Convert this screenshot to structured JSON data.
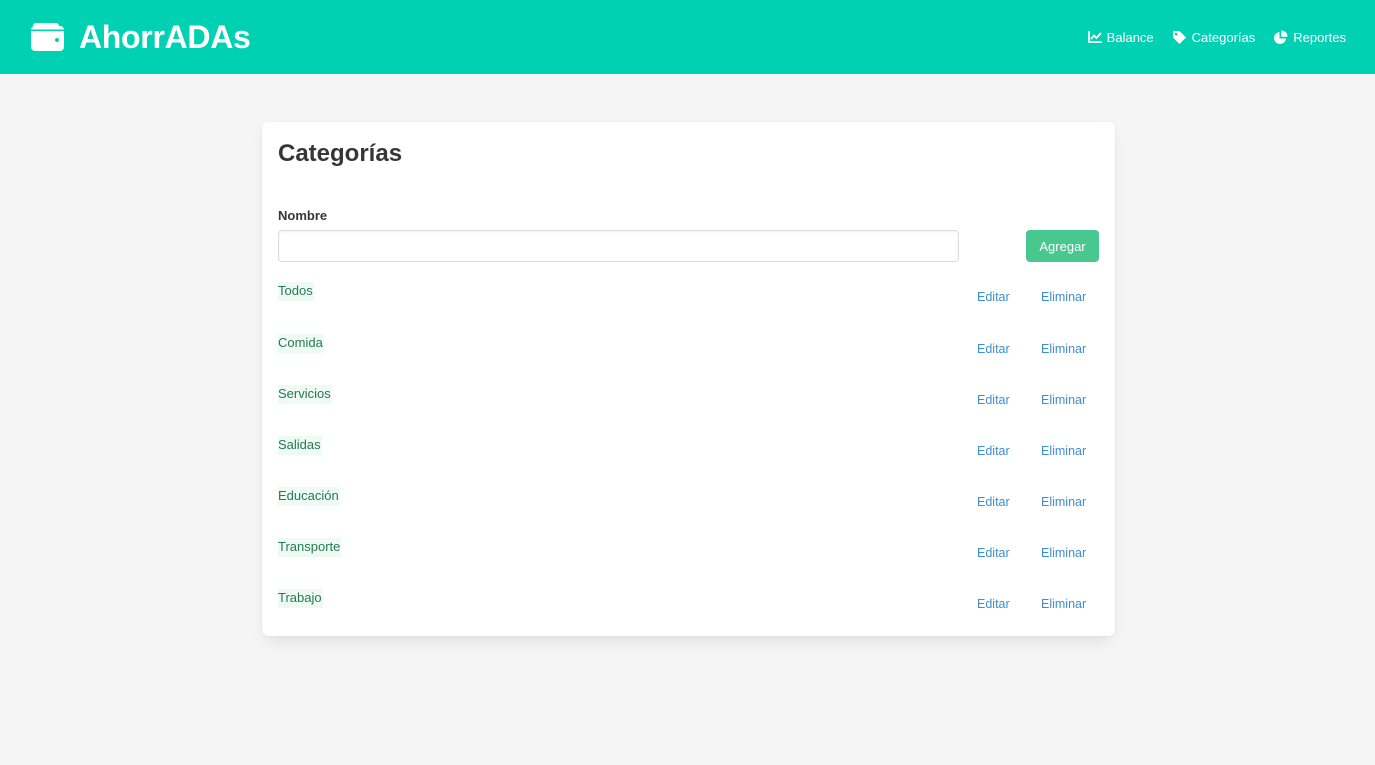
{
  "brand": {
    "title": "AhorrADAs",
    "icon": "wallet-icon"
  },
  "nav": {
    "items": [
      {
        "label": "Balance",
        "icon": "chart-line-icon"
      },
      {
        "label": "Categorías",
        "icon": "tag-icon"
      },
      {
        "label": "Reportes",
        "icon": "pie-chart-icon"
      }
    ]
  },
  "page": {
    "title": "Categorías",
    "form": {
      "name_label": "Nombre",
      "name_value": "",
      "add_label": "Agregar"
    },
    "categories": [
      {
        "name": "Todos",
        "edit_label": "Editar",
        "delete_label": "Eliminar"
      },
      {
        "name": "Comida",
        "edit_label": "Editar",
        "delete_label": "Eliminar"
      },
      {
        "name": "Servicios",
        "edit_label": "Editar",
        "delete_label": "Eliminar"
      },
      {
        "name": "Salidas",
        "edit_label": "Editar",
        "delete_label": "Eliminar"
      },
      {
        "name": "Educación",
        "edit_label": "Editar",
        "delete_label": "Eliminar"
      },
      {
        "name": "Transporte",
        "edit_label": "Editar",
        "delete_label": "Eliminar"
      },
      {
        "name": "Trabajo",
        "edit_label": "Editar",
        "delete_label": "Eliminar"
      }
    ]
  },
  "colors": {
    "navbar": "#00d1b2",
    "add_button": "#48c78e",
    "tag_background": "#effaf5",
    "tag_text": "#257953",
    "link": "#3e8ed0",
    "page_background": "#f5f5f5"
  }
}
